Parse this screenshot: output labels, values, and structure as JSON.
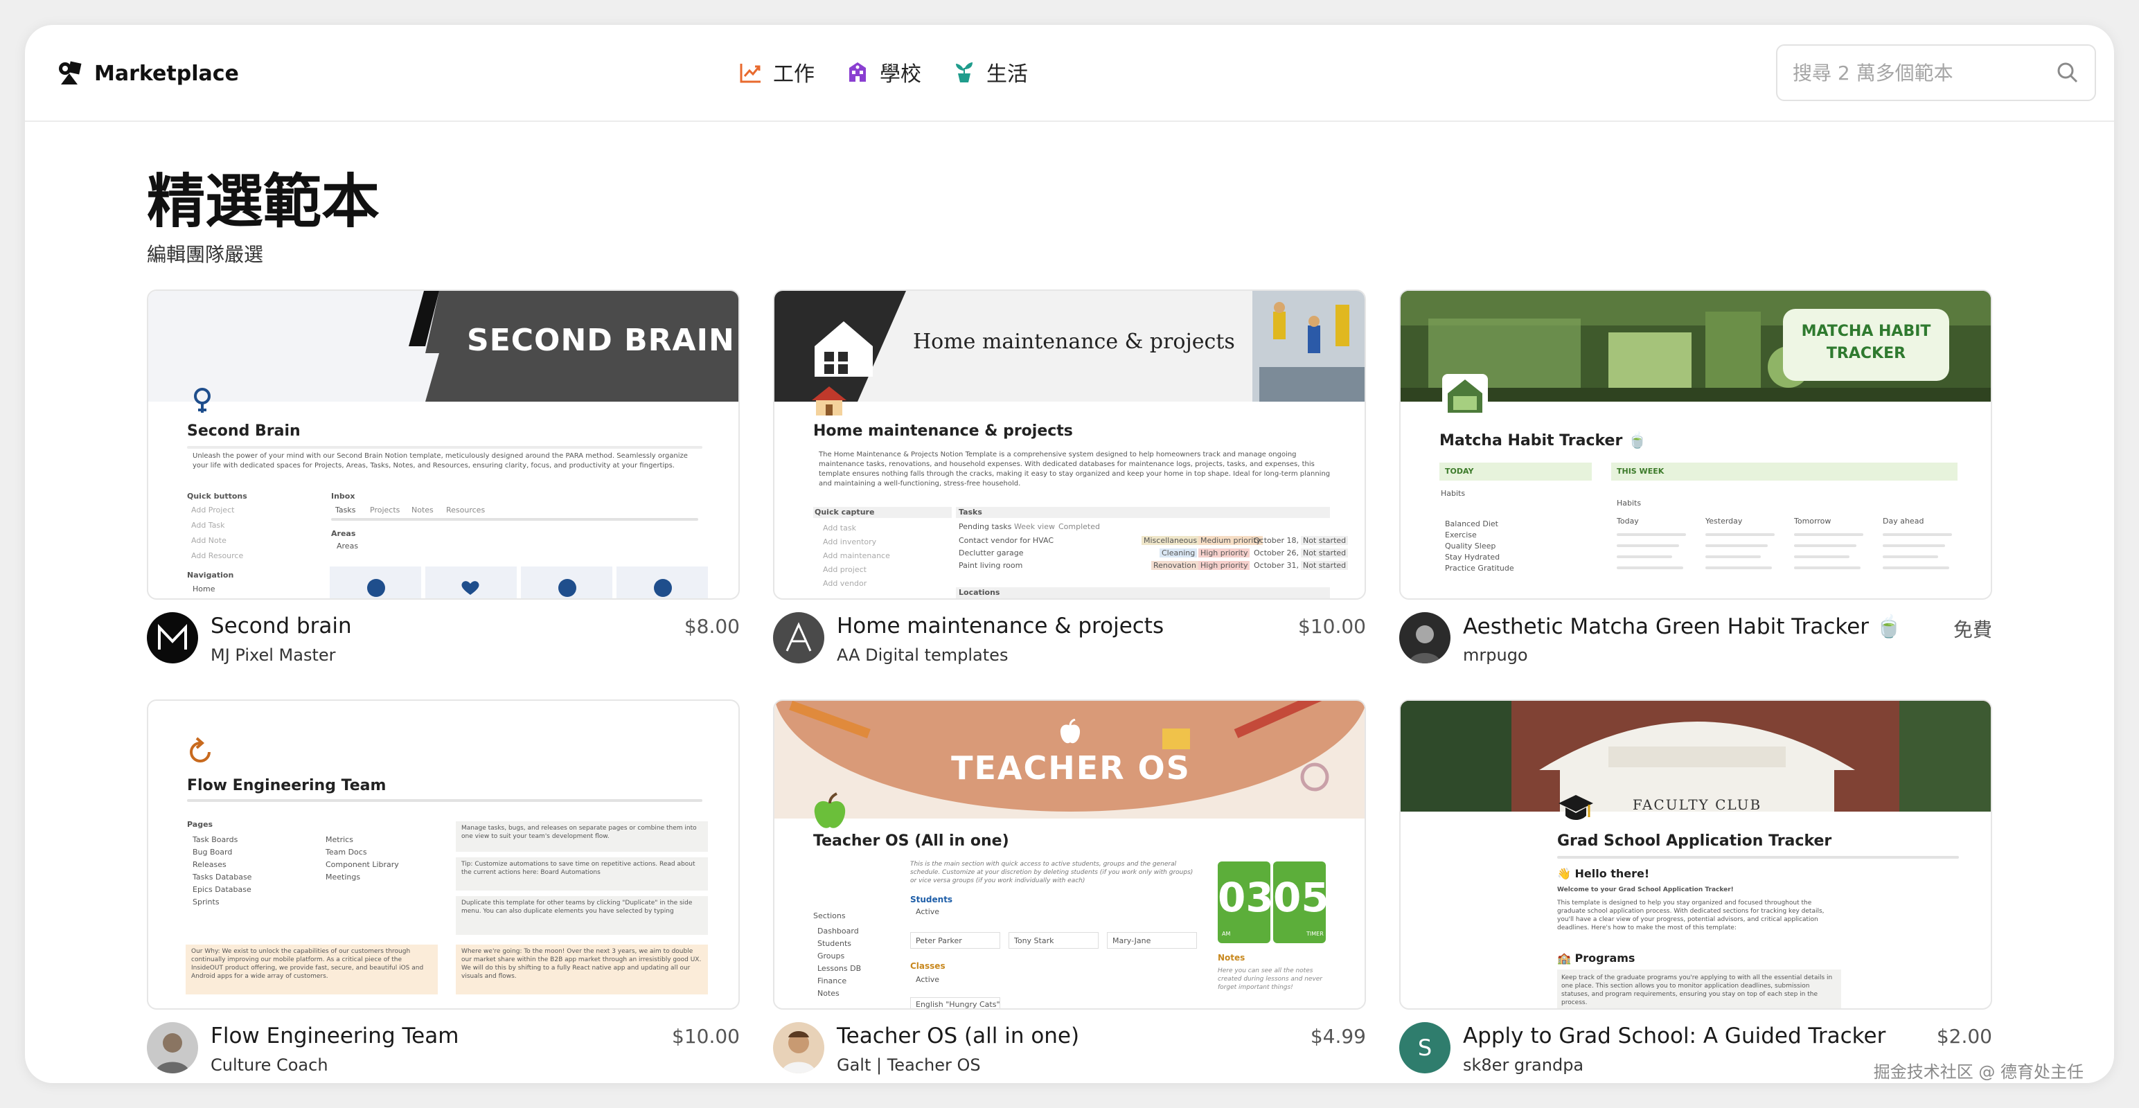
{
  "header": {
    "logo_text": "Marketplace",
    "nav": [
      {
        "label": "工作",
        "icon": "trend-chart-icon",
        "color": "#e86a2e"
      },
      {
        "label": "學校",
        "icon": "school-building-icon",
        "color": "#8a3fd1"
      },
      {
        "label": "生活",
        "icon": "plant-pot-icon",
        "color": "#1f9c8c"
      }
    ],
    "search_placeholder": "搜尋 2 萬多個範本"
  },
  "section": {
    "title": "精選範本",
    "subtitle": "編輯團隊嚴選"
  },
  "cards": [
    {
      "title": "Second brain",
      "author": "MJ Pixel Master",
      "price": "$8.00",
      "thumb": {
        "banner": "SECOND BRAIN",
        "doc_title": "Second Brain",
        "desc": "Unleash the power of your mind with our Second Brain Notion template, meticulously designed around the PARA method. Seamlessly organize your life with dedicated spaces for Projects, Areas, Tasks, Notes, and Resources, ensuring clarity, focus, and productivity at your fingertips.",
        "quick_buttons": "Quick buttons",
        "inbox": "Inbox",
        "areas": "Areas",
        "navigation": "Navigation",
        "tabs": [
          "Tasks",
          "Projects",
          "Notes",
          "Resources"
        ],
        "qb_items": [
          "Add Project",
          "Add Task",
          "Add Note",
          "Add Resource"
        ],
        "areas_item": "Areas",
        "home": "Home"
      }
    },
    {
      "title": "Home maintenance & projects",
      "author": "AA Digital templates",
      "price": "$10.00",
      "thumb": {
        "banner": "Home maintenance & projects",
        "doc_title": "Home maintenance & projects",
        "desc": "The Home Maintenance & Projects Notion Template is a comprehensive system designed to help homeowners track and manage ongoing maintenance tasks, renovations, and household expenses. With dedicated databases for maintenance logs, projects, tasks, and expenses, this template ensures nothing falls through the cracks, making it easy to stay organized and keep your home in top shape. Ideal for long-term planning and maintaining a well-functioning, stress-free household.",
        "quick_capture": "Quick capture",
        "tasks": "Tasks",
        "locations": "Locations",
        "qc_items": [
          "Add task",
          "Add inventory",
          "Add maintenance",
          "Add project",
          "Add vendor"
        ],
        "task_tabs": [
          "Pending tasks",
          "Week view",
          "Completed"
        ],
        "task_rows": [
          {
            "name": "Contact vendor for HVAC",
            "tag": "Miscellaneous",
            "prio": "Medium priority",
            "date": "October 18, 2024",
            "status": "Not started"
          },
          {
            "name": "Declutter garage",
            "tag": "Cleaning",
            "prio": "High priority",
            "date": "October 26, 2024",
            "status": "Not started"
          },
          {
            "name": "Paint living room",
            "tag": "Renovation",
            "prio": "High priority",
            "date": "October 31, 2024",
            "status": "Not started"
          }
        ]
      }
    },
    {
      "title": "Aesthetic Matcha Green Habit Tracker 🍵",
      "author": "mrpugo",
      "price": "免費",
      "thumb": {
        "badge_l1": "MATCHA HABIT",
        "badge_l2": "TRACKER",
        "doc_title": "Matcha Habit Tracker 🍵",
        "today": "TODAY",
        "this_week": "THIS WEEK",
        "habits": "Habits",
        "day_cols": [
          "Today",
          "Yesterday",
          "Tomorrow",
          "Day ahead"
        ],
        "habit_items": [
          "Balanced Diet",
          "Exercise",
          "Quality Sleep",
          "Stay Hydrated",
          "Practice Gratitude"
        ]
      }
    },
    {
      "title": "Flow Engineering Team",
      "author": "Culture Coach",
      "price": "$10.00",
      "thumb": {
        "doc_title": "Flow Engineering Team",
        "pages": "Pages",
        "pages_left": [
          "Task Boards",
          "Bug Board",
          "Releases",
          "Tasks Database",
          "Epics Database",
          "Sprints"
        ],
        "pages_right": [
          "Metrics",
          "Team Docs",
          "Component Library",
          "Meetings"
        ],
        "callout1": "Manage tasks, bugs, and releases on separate pages or combine them into one view to suit your team's development flow.",
        "callout2": "Tip: Customize automations to save time on repetitive actions. Read about the current actions here: Board Automations",
        "callout3": "Duplicate this template for other teams by clicking \"Duplicate\" in the side menu. You can also duplicate elements you have selected by typing",
        "why": "Our Why: We exist to unlock the capabilities of our customers through continually improving our mobile platform. As a critical piece of the InsideOUT product offering, we provide fast, secure, and beautiful iOS and Android apps for a wide array of customers.",
        "where": "Where we're going: To the moon! Over the next 3 years, we aim to double our market share within the B2B app market through an irresistibly good UX. We will do this by shifting to a fully React native app and updating all our visuals and flows."
      }
    },
    {
      "title": "Teacher OS (all in one)",
      "author": "Galt | Teacher OS",
      "price": "$4.99",
      "thumb": {
        "banner": "TEACHER OS",
        "doc_title": "Teacher OS (All in one)",
        "intro": "This is the main section with quick access to active students, groups and the general schedule. Customize at your discretion by deleting students (if you work only with groups) or vice versa groups (if you work individually with each)",
        "students": "Students",
        "classes": "Classes",
        "notes": "Notes",
        "active": "Active",
        "student_names": [
          "Peter Parker",
          "Tony Stark",
          "Mary-Jane"
        ],
        "sections": "Sections",
        "section_items": [
          "Dashboard",
          "Students",
          "Groups",
          "Lessons DB",
          "Finance",
          "Notes"
        ],
        "clock_h": "03",
        "clock_m": "05",
        "am": "AM",
        "timer": "TIMER",
        "notes_text": "Here you can see all the notes created during lessons and never forget important things!",
        "class_item": "English \"Hungry Cats\""
      }
    },
    {
      "title": "Apply to Grad School: A Guided Tracker",
      "author": "sk8er grandpa",
      "price": "$2.00",
      "thumb": {
        "building_sign": "FACULTY CLUB",
        "doc_title": "Grad School Application Tracker",
        "hello": "👋 Hello there!",
        "welcome": "Welcome to your Grad School Application Tracker!",
        "body": "This template is designed to help you stay organized and focused throughout the graduate school application process. With dedicated sections for tracking key details, you'll have a clear view of your progress, potential advisors, and critical application deadlines. Here's how to make the most of this template:",
        "programs": "🏫 Programs",
        "programs_text": "Keep track of the graduate programs you're applying to with all the essential details in one place. This section allows you to monitor application deadlines, submission statuses, and program requirements, ensuring you stay on top of each step in the process."
      }
    }
  ],
  "avatars": {
    "card6_initial": "S",
    "card6_color": "#2f7d6d"
  },
  "watermark": "掘金技术社区 @ 德育处主任"
}
